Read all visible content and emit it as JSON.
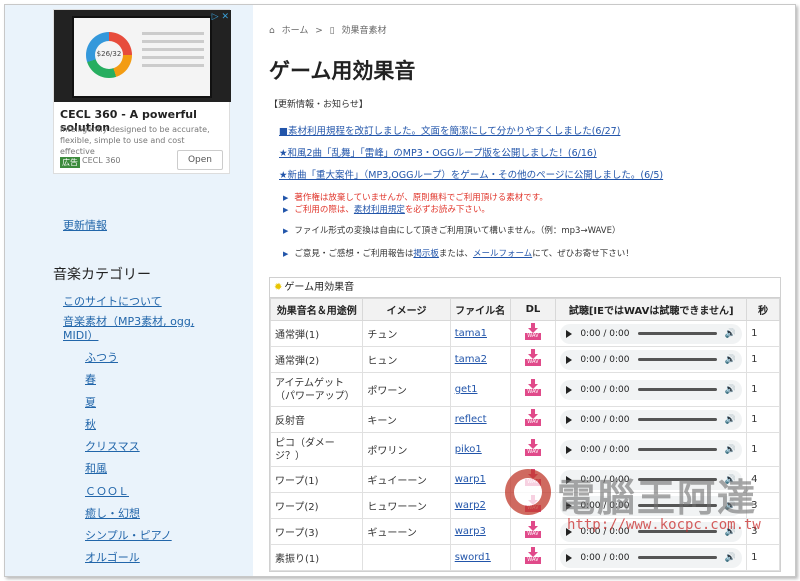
{
  "ad": {
    "choice": "▷ ✕",
    "chart_value": "$26/32",
    "title": "CECL 360 - A powerful solution",
    "desc": "Intelligently designed to be accurate, flexible, simple to use and cost effective",
    "badge": "広告",
    "brand": "CECL 360",
    "open": "Open"
  },
  "sidebar": {
    "update": "更新情報",
    "heading": "音楽カテゴリー",
    "links": [
      "このサイトについて",
      "音楽素材（MP3素材, ogg, MIDI）"
    ],
    "subs": [
      "ふつう",
      "春",
      "夏",
      "秋",
      "クリスマス",
      "和風",
      "ＣＯＯＬ",
      "癒し・幻想",
      "シンプル・ピアノ",
      "オルゴール"
    ]
  },
  "breadcrumb": {
    "home": "ホーム",
    "sep": ">",
    "current": "効果音素材"
  },
  "page": {
    "title": "ゲーム用効果音"
  },
  "news": {
    "head": "【更新情報・お知らせ】",
    "items": [
      "■素材利用規程を改訂しました。文面を簡潔にして分かりやすくしました(6/27)",
      "★和風2曲「乱舞」「雷峰」のMP3・OGGループ版を公開しました！(6/16)",
      "★新曲「重大案件」（MP3,OGGループ）をゲーム・その他のページに公開しました。(6/5)"
    ]
  },
  "notes": {
    "n1": "著作権は放棄していませんが、原則無料でご利用頂ける素材です。",
    "n2a": "ご利用の際は、",
    "n2link": "素材利用規定",
    "n2b": "を必ずお読み下さい。",
    "n3": "ファイル形式の変換は自由にして頂きご利用頂いて構いません。（例：mp3→WAVE）",
    "n4a": "ご意見・ご感想・ご利用報告は",
    "n4link1": "掲示板",
    "n4b": "または、",
    "n4link2": "メールフォーム",
    "n4c": "にて、ぜひお寄せ下さい！"
  },
  "table": {
    "caption": "ゲーム用効果音",
    "headers": [
      "効果音名＆用途例",
      "イメージ",
      "ファイル名",
      "DL",
      "試聴[IEではWAVは試聴できません]",
      "秒"
    ],
    "player_time": "0:00 / 0:00",
    "rows": [
      {
        "name": "通常弾(1)",
        "image": "チュン",
        "file": "tama1",
        "sec": "1"
      },
      {
        "name": "通常弾(2)",
        "image": "ヒュン",
        "file": "tama2",
        "sec": "1"
      },
      {
        "name": "アイテムゲット（パワーアップ）",
        "image": "ポワーン",
        "file": "get1",
        "sec": "1"
      },
      {
        "name": "反射音",
        "image": "キーン",
        "file": "reflect",
        "sec": "1"
      },
      {
        "name": "ピコ（ダメージ？）",
        "image": "ポワリン",
        "file": "piko1",
        "sec": "1"
      },
      {
        "name": "ワープ(1)",
        "image": "ギュイーーン",
        "file": "warp1",
        "sec": "4"
      },
      {
        "name": "ワープ(2)",
        "image": "ヒュワーーン",
        "file": "warp2",
        "sec": "3"
      },
      {
        "name": "ワープ(3)",
        "image": "ギューーン",
        "file": "warp3",
        "sec": "3"
      },
      {
        "name": "素振り(1)",
        "image": "",
        "file": "sword1",
        "sec": "1"
      }
    ]
  },
  "watermark": {
    "text": "電腦王阿達",
    "url": "http://www.kocpc.com.tw"
  }
}
